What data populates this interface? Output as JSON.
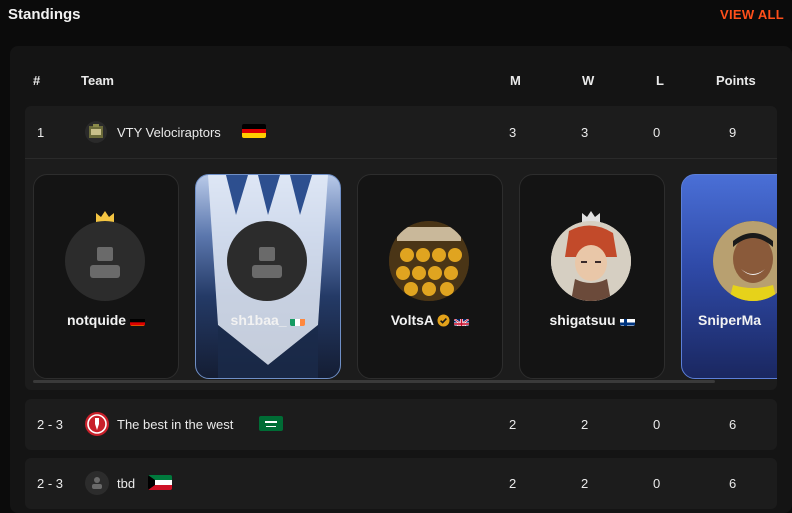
{
  "header": {
    "title": "Standings",
    "view_all": "VIEW ALL"
  },
  "columns": {
    "rank": "#",
    "team": "Team",
    "m": "M",
    "w": "W",
    "l": "L",
    "points": "Points"
  },
  "rows": [
    {
      "rank": "1",
      "team": "VTY Velociraptors",
      "flag": "germany",
      "m": "3",
      "w": "3",
      "l": "0",
      "points": "9"
    },
    {
      "rank": "2 - 3",
      "team": "The best in the west",
      "flag": "saudi-arabia",
      "m": "2",
      "w": "2",
      "l": "0",
      "points": "6"
    },
    {
      "rank": "2 - 3",
      "team": "tbd",
      "flag": "kuwait",
      "m": "2",
      "w": "2",
      "l": "0",
      "points": "6"
    }
  ],
  "players": [
    {
      "name": "notquide",
      "flag": "germany",
      "captain": true,
      "avatar": "placeholder"
    },
    {
      "name": "sh1baa_",
      "flag": "ireland",
      "captain": false,
      "avatar": "placeholder"
    },
    {
      "name": "VoltsA",
      "flag": "united-kingdom",
      "captain": false,
      "verified": true,
      "avatar": "photo"
    },
    {
      "name": "shigatsuu",
      "flag": "finland",
      "captain": true,
      "avatar": "photo"
    },
    {
      "name": "SniperMa",
      "flag": "",
      "captain": false,
      "avatar": "photo"
    }
  ],
  "colors": {
    "accent": "#ff4f1a",
    "crown": "#f4c542"
  }
}
